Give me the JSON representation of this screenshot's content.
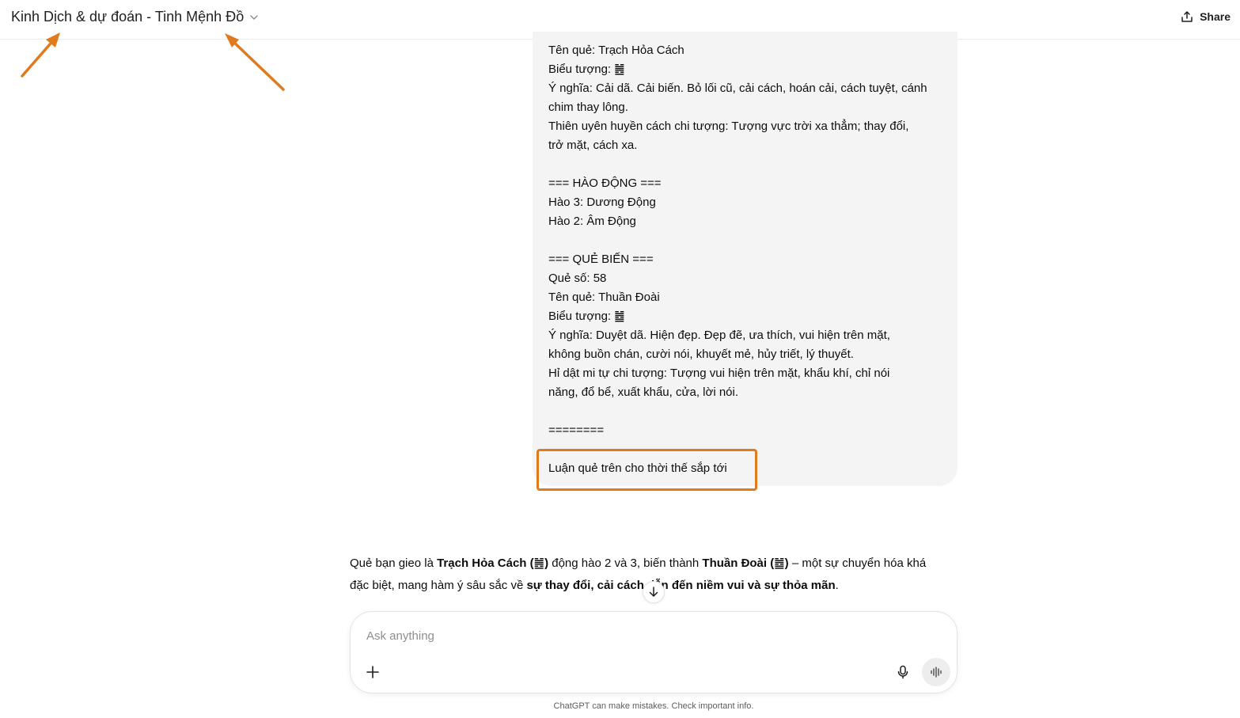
{
  "header": {
    "title": "Kinh Dịch & dự đoán - Tinh Mệnh Đồ",
    "share_label": "Share"
  },
  "user_message": {
    "lines": [
      "Tên quẻ: Trạch Hỏa Cách",
      "Biểu tượng: ䷰",
      "Ý nghĩa: Cải dã. Cải biến. Bỏ lối cũ, cải cách, hoán cải, cách tuyệt, cánh",
      "chim thay lông.",
      "Thiên uyên huyền cách chi tượng: Tượng vực trời xa thẳm; thay đổi,",
      "trở mặt, cách xa.",
      "",
      "=== HÀO ĐỘNG ===",
      "Hào 3: Dương Động",
      "Hào 2: Âm Động",
      "",
      "=== QUẺ BIẾN ===",
      "Quẻ số: 58",
      "Tên quẻ: Thuần Đoài",
      "Biểu tượng: ䷹",
      "Ý nghĩa: Duyệt dã. Hiện đẹp. Đẹp đẽ, ưa thích, vui hiện trên mặt,",
      "không buồn chán, cười nói, khuyết mẻ, hủy triết, lý thuyết.",
      "Hỉ dật mi tự chi tượng: Tượng vui hiện trên mặt, khẩu khí, chỉ nói",
      "năng, đổ bể, xuất khẩu, cửa, lời nói.",
      "",
      "========",
      "",
      "Luận quẻ trên cho thời thế sắp tới"
    ]
  },
  "assistant_message": {
    "p1_a": "Quẻ bạn gieo là ",
    "p1_b": "Trạch Hỏa Cách (䷰)",
    "p1_c": " động hào 2 và 3, biến thành ",
    "p1_d": "Thuần Đoài (䷹)",
    "p1_e": " – một sự chuyển hóa khá",
    "p2_a": "đặc biệt, mang hàm ý sâu sắc về ",
    "p2_b": "sự thay đổi, cải cách dẫn đến niềm vui và sự thỏa mãn",
    "p2_c": "."
  },
  "composer": {
    "placeholder": "Ask anything"
  },
  "footer": {
    "disclaimer": "ChatGPT can make mistakes. Check important info."
  },
  "icons": {
    "chevron": "chevron-down-icon",
    "share": "share-icon",
    "plus": "plus-icon",
    "mic": "microphone-icon",
    "voice": "voice-mode-icon",
    "scroll": "arrow-down-icon"
  },
  "colors": {
    "annotation": "#e07a1f",
    "bubble_bg": "#f4f4f4"
  }
}
